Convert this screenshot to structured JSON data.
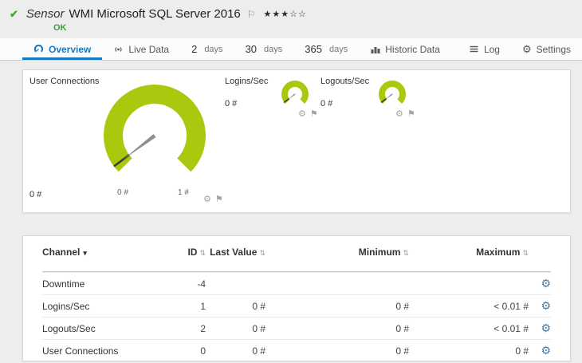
{
  "colors": {
    "accent_green": "#a9c90e",
    "ok_green": "#38a33a",
    "tab_blue": "#1779be",
    "needle_gray": "#8f8f8f"
  },
  "header": {
    "kind": "Sensor",
    "title": "WMI Microsoft SQL Server 2016",
    "stars": "★★★☆☆",
    "status": "OK"
  },
  "icons": {
    "check": "✔",
    "flag": "⚐",
    "gear": "⚙",
    "pin": "⚑",
    "sort": "⇅",
    "dropdown": "▾"
  },
  "tabs": [
    {
      "label": "Overview"
    },
    {
      "label": "Live Data"
    },
    {
      "number": "2",
      "unit": "days"
    },
    {
      "number": "30",
      "unit": "days"
    },
    {
      "number": "365",
      "unit": "days"
    },
    {
      "label": "Historic Data"
    },
    {
      "label": "Log"
    },
    {
      "label": "Settings"
    }
  ],
  "gauges": {
    "main": {
      "title": "User Connections",
      "value": "0 #",
      "scale_min": "0 #",
      "scale_max": "1 #"
    },
    "logins": {
      "title": "Logins/Sec",
      "value": "0 #"
    },
    "logouts": {
      "title": "Logouts/Sec",
      "value": "0 #"
    }
  },
  "table": {
    "headers": {
      "channel": "Channel",
      "id": "ID",
      "last": "Last Value",
      "min": "Minimum",
      "max": "Maximum"
    },
    "rows": [
      {
        "channel": "Downtime",
        "id": "-4",
        "last": "",
        "min": "",
        "max": ""
      },
      {
        "channel": "Logins/Sec",
        "id": "1",
        "last": "0 #",
        "min": "0 #",
        "max": "< 0.01 #"
      },
      {
        "channel": "Logouts/Sec",
        "id": "2",
        "last": "0 #",
        "min": "0 #",
        "max": "< 0.01 #"
      },
      {
        "channel": "User Connections",
        "id": "0",
        "last": "0 #",
        "min": "0 #",
        "max": "0 #"
      }
    ]
  }
}
